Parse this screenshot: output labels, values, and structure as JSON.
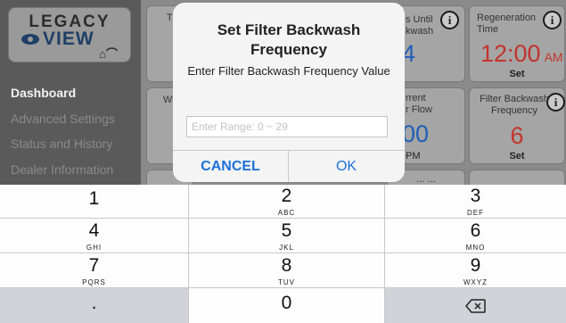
{
  "logo": {
    "line1": "LEGACY",
    "line2": "VIEW"
  },
  "sidebar": {
    "items": [
      {
        "label": "Dashboard"
      },
      {
        "label": "Advanced Settings"
      },
      {
        "label": "Status and History"
      },
      {
        "label": "Dealer Information"
      }
    ]
  },
  "tiles": {
    "days_until": {
      "title": "s Until\nkwash",
      "value": "4"
    },
    "regeneration": {
      "title": "Regeneration\nTime",
      "time": "12:00",
      "ampm": "AM",
      "action": "Set"
    },
    "flow": {
      "title": "rrent\nr Flow",
      "value": "00",
      "unit": "PM"
    },
    "filter_backwash": {
      "title": "Filter Backwash\nFrequency",
      "value": "6",
      "action": "Set"
    },
    "partial_left1": {
      "title": "T"
    },
    "partial_left2": {
      "title": "W"
    },
    "partial_bottom": {
      "title": "... ..."
    }
  },
  "colors": {
    "accent_blue": "#1e6fd9",
    "value_blue": "#1f5fb8",
    "value_red": "#c2342c"
  },
  "dialog": {
    "title": "Set Filter Backwash Frequency",
    "message": "Enter Filter Backwash Frequency Value",
    "input_placeholder": "Enter Range: 0 ~ 29",
    "input_value": "",
    "cancel_label": "CANCEL",
    "ok_label": "OK"
  },
  "keypad": {
    "keys": [
      {
        "num": "1",
        "letters": ""
      },
      {
        "num": "2",
        "letters": "ABC"
      },
      {
        "num": "3",
        "letters": "DEF"
      },
      {
        "num": "4",
        "letters": "GHI"
      },
      {
        "num": "5",
        "letters": "JKL"
      },
      {
        "num": "6",
        "letters": "MNO"
      },
      {
        "num": "7",
        "letters": "PQRS"
      },
      {
        "num": "8",
        "letters": "TUV"
      },
      {
        "num": "9",
        "letters": "WXYZ"
      },
      {
        "num": ".",
        "letters": ""
      },
      {
        "num": "0",
        "letters": ""
      },
      {
        "num": "",
        "letters": "",
        "icon": "backspace-icon"
      }
    ]
  }
}
